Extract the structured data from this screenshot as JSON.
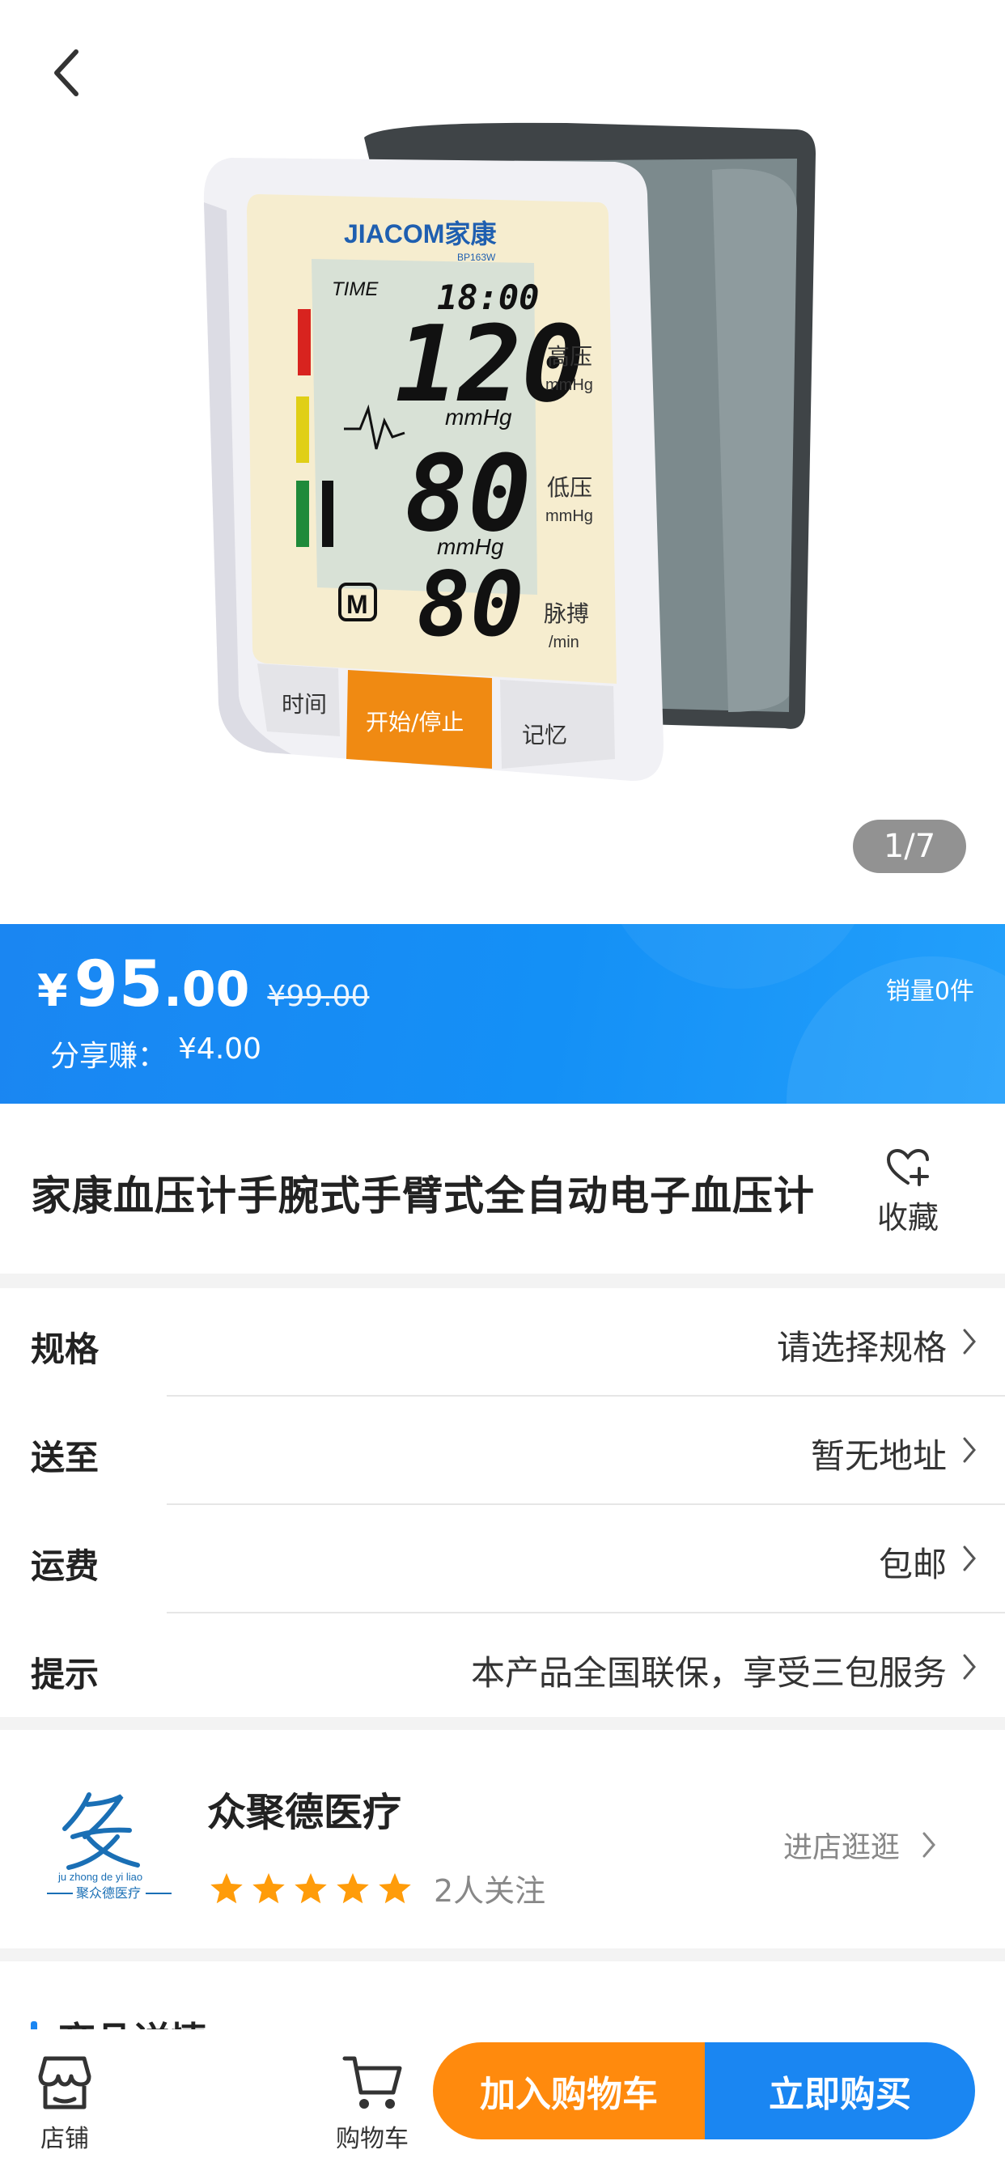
{
  "gallery": {
    "counter": "1/7",
    "device": {
      "brand": "JIACOM家康",
      "model": "BP163W",
      "time_label": "TIME",
      "time_value": "18:00",
      "systolic": "120",
      "diastolic": "80",
      "pulse": "80",
      "unit": "mmHg",
      "memory_badge": "M",
      "label_high": "高压",
      "label_low": "低压",
      "label_pulse": "脉搏",
      "unit_pulse": "/min",
      "btn_time": "时间",
      "btn_start": "开始/停止",
      "btn_memory": "记忆"
    }
  },
  "price": {
    "symbol": "¥",
    "integer": "95",
    "decimal": ".00",
    "original": "¥99.00",
    "share_label": "分享赚：",
    "share_value": "¥4.00",
    "sales_label": "销量",
    "sales_value": "0件"
  },
  "product": {
    "title": "家康血压计手腕式手臂式全自动电子血压计",
    "favorite_label": "收藏"
  },
  "info_rows": [
    {
      "label": "规格",
      "value": "请选择规格"
    },
    {
      "label": "送至",
      "value": "暂无地址"
    },
    {
      "label": "运费",
      "value": "包邮"
    },
    {
      "label": "提示",
      "value": "本产品全国联保，享受三包服务"
    }
  ],
  "shop": {
    "name": "众聚德医疗",
    "logo_text_top": "ju zhong de yi liao",
    "logo_text_bottom": "聚众德医疗",
    "rating": 5,
    "followers": "2人关注",
    "enter_label": "进店逛逛"
  },
  "details": {
    "title": "商品详情"
  },
  "bottom_bar": {
    "shop_label": "店铺",
    "cart_label": "购物车",
    "add_to_cart": "加入购物车",
    "buy_now": "立即购买"
  },
  "colors": {
    "primary_blue": "#1a86f2",
    "accent_orange": "#ff8a0d",
    "star": "#ff9c0a"
  }
}
